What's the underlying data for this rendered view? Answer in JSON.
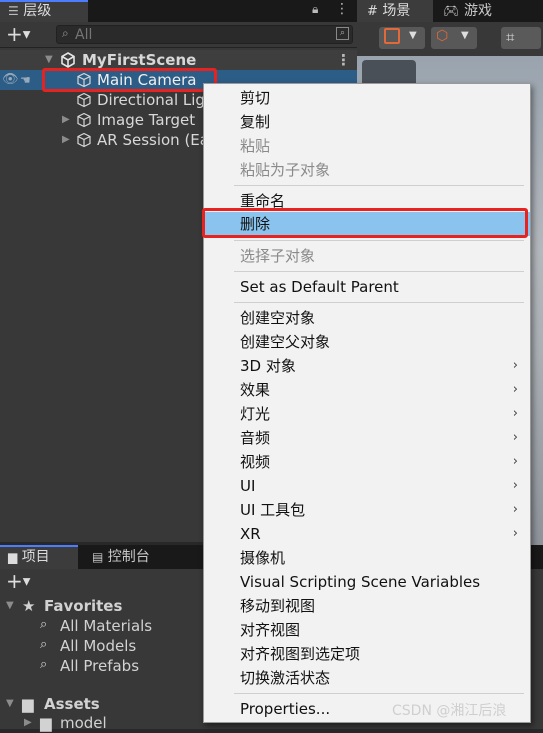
{
  "hierarchy": {
    "tab_label": "层级",
    "search_placeholder": "All",
    "scene_name": "MyFirstScene",
    "items": [
      {
        "label": "Main Camera"
      },
      {
        "label": "Directional Lig"
      },
      {
        "label": "Image Target"
      },
      {
        "label": "AR Session (Ea"
      }
    ]
  },
  "scene": {
    "tabs": [
      {
        "label": "场景"
      },
      {
        "label": "游戏"
      }
    ]
  },
  "context_menu": {
    "items": [
      {
        "label": "剪切",
        "enabled": true
      },
      {
        "label": "复制",
        "enabled": true
      },
      {
        "label": "粘贴",
        "enabled": false
      },
      {
        "label": "粘贴为子对象",
        "enabled": false
      },
      {
        "label": "重命名",
        "enabled": true
      },
      {
        "label": "删除",
        "enabled": true,
        "highlighted": true
      },
      {
        "label": "选择子对象",
        "enabled": false
      },
      {
        "label": "Set as Default Parent",
        "enabled": true
      },
      {
        "label": "创建空对象",
        "enabled": true
      },
      {
        "label": "创建空父对象",
        "enabled": true
      },
      {
        "label": "3D 对象",
        "enabled": true,
        "submenu": true
      },
      {
        "label": "效果",
        "enabled": true,
        "submenu": true
      },
      {
        "label": "灯光",
        "enabled": true,
        "submenu": true
      },
      {
        "label": "音频",
        "enabled": true,
        "submenu": true
      },
      {
        "label": "视频",
        "enabled": true,
        "submenu": true
      },
      {
        "label": "UI",
        "enabled": true,
        "submenu": true
      },
      {
        "label": "UI 工具包",
        "enabled": true,
        "submenu": true
      },
      {
        "label": "XR",
        "enabled": true,
        "submenu": true
      },
      {
        "label": "摄像机",
        "enabled": true
      },
      {
        "label": "Visual Scripting Scene Variables",
        "enabled": true
      },
      {
        "label": "移动到视图",
        "enabled": true
      },
      {
        "label": "对齐视图",
        "enabled": true
      },
      {
        "label": "对齐视图到选定项",
        "enabled": true
      },
      {
        "label": "切换激活状态",
        "enabled": true
      },
      {
        "label": "Properties...",
        "enabled": true
      }
    ]
  },
  "project": {
    "tabs": [
      {
        "label": "项目"
      },
      {
        "label": "控制台"
      }
    ],
    "favorites_label": "Favorites",
    "favorites": [
      {
        "label": "All Materials"
      },
      {
        "label": "All Models"
      },
      {
        "label": "All Prefabs"
      }
    ],
    "assets_label": "Assets",
    "assets_children": [
      {
        "label": "model"
      }
    ]
  },
  "watermark": "CSDN @湘江后浪",
  "colors": {
    "highlight": "#8ac4ee",
    "selection": "#2c5d87",
    "annotation_red": "#e8231f"
  }
}
